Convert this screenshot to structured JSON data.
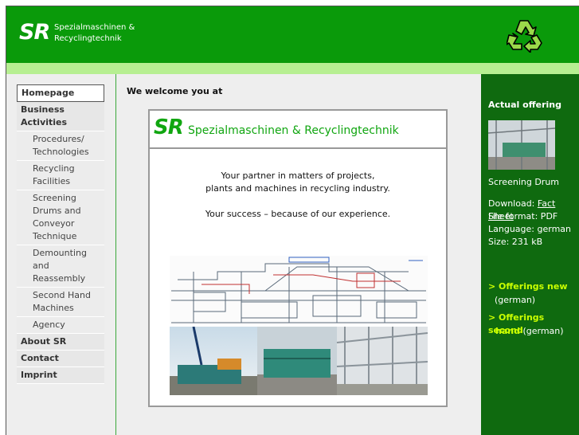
{
  "header": {
    "logo_letters": "SR",
    "logo_line1": "Spezialmaschinen &",
    "logo_line2": "Recyclingtechnik"
  },
  "nav": {
    "items": [
      {
        "label": "Homepage",
        "type": "main",
        "active": true
      },
      {
        "label": "Business Activities",
        "type": "main"
      },
      {
        "label": "Procedures/ Technologies",
        "type": "sub"
      },
      {
        "label": "Recycling Facilities",
        "type": "sub"
      },
      {
        "label": "Screening Drums and Conveyor Technique",
        "type": "sub"
      },
      {
        "label": "Demounting and Reassembly",
        "type": "sub"
      },
      {
        "label": "Second Hand Machines",
        "type": "sub"
      },
      {
        "label": "Agency",
        "type": "sub"
      },
      {
        "label": "About SR",
        "type": "main"
      },
      {
        "label": "Contact",
        "type": "main"
      },
      {
        "label": "Imprint",
        "type": "main"
      }
    ]
  },
  "main": {
    "welcome": "We welcome you at",
    "box_logo": "SR",
    "box_title": "Spezialmaschinen & Recyclingtechnik",
    "line1": "Your partner in matters of projects,",
    "line2": "plants and machines in recycling industry.",
    "line3": "Your success – because of our experience."
  },
  "right": {
    "title": "Actual offering",
    "caption": "Screening Drum",
    "download_label": "Download: ",
    "download_link": "Fact Sheet",
    "file_format": "File format: PDF",
    "language": "Language: german",
    "size": "Size: 231 kB",
    "offer_new": "> Offerings new",
    "offer_new_lang": "(german)",
    "offer_second_1": "> Offerings second",
    "offer_second_2": "hand",
    "offer_second_lang": "(german)"
  },
  "colors": {
    "header_green": "#0a9a0a",
    "light_bar": "#b7ef92",
    "right_panel": "#0f6a0f",
    "accent_text": "#11a611"
  }
}
